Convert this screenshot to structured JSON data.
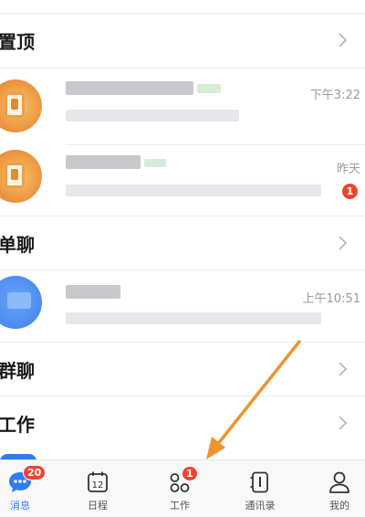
{
  "sections": {
    "pinned": "置顶",
    "single": "单聊",
    "group": "群聊",
    "work": "工作"
  },
  "chats": [
    {
      "time": "下午3:22",
      "unread": "",
      "avatar_color": "#f0a24a"
    },
    {
      "time": "昨天",
      "unread": "1",
      "avatar_color": "#f0a24a"
    },
    {
      "time": "上午10:51",
      "unread": "",
      "avatar_color": "#4f8ef2"
    }
  ],
  "tabbar": {
    "tabs": [
      {
        "label": "消息",
        "icon": "chat-bubble-icon",
        "badge": "20",
        "active": true
      },
      {
        "label": "日程",
        "icon": "calendar-icon",
        "calendar_day": "12",
        "active": false
      },
      {
        "label": "工作",
        "icon": "apps-grid-icon",
        "badge": "1",
        "active": false
      },
      {
        "label": "通讯录",
        "icon": "contacts-book-icon",
        "active": false
      },
      {
        "label": "我的",
        "icon": "profile-icon",
        "active": false
      }
    ]
  },
  "annotation": {
    "type": "arrow",
    "color": "#f0922e",
    "points_to": "工作"
  }
}
